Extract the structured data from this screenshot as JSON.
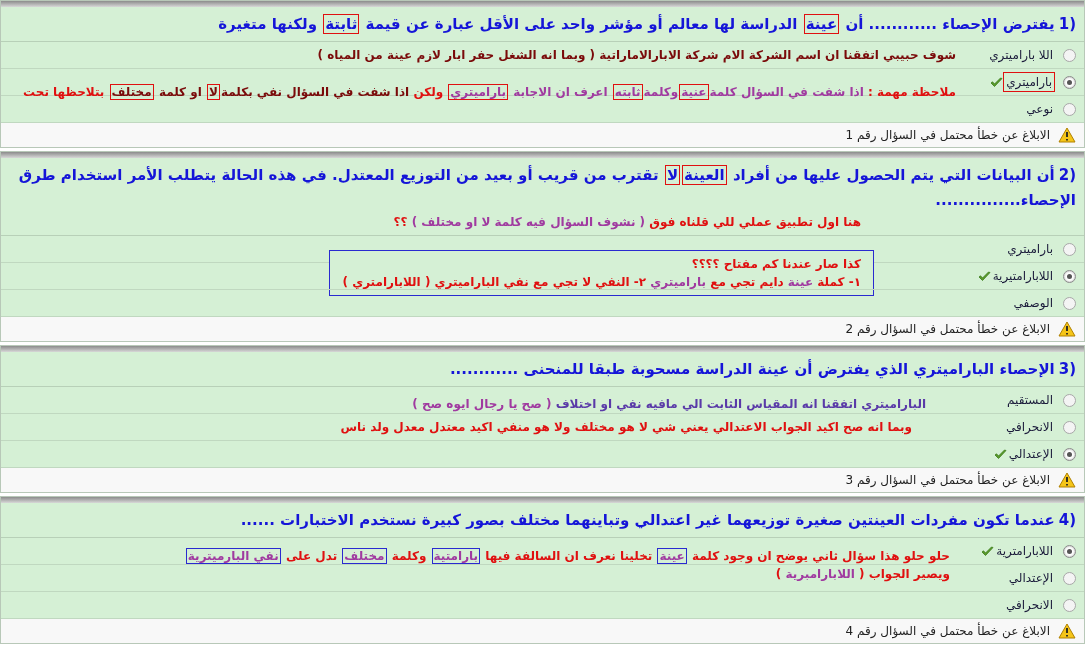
{
  "questions": [
    {
      "number": "1)",
      "text": [
        {
          "text": "يفترض الإحصاء ............ أن ",
          "color": "#1515d8"
        },
        {
          "text": "عينة",
          "color": "#1515d8",
          "boxed": true
        },
        {
          "text": " الدراسة لها معالم أو مؤشر واحد على الأقل عبارة عن قيمة ",
          "color": "#1515d8"
        },
        {
          "text": "ثابتة",
          "color": "#1515d8",
          "boxed": true
        },
        {
          "text": " ولكنها متغيرة",
          "color": "#1515d8"
        }
      ],
      "options": [
        {
          "label": "اللا باراميتري",
          "selected": false,
          "correct": false,
          "notes": [
            {
              "kind": "plain",
              "lines": [
                [
                  {
                    "text": "شوف حبيبي اتفقنا ان اسم الشركة الام شركة الابارالاماراتية ( وبما انه الشغل حفر ابار لازم عينة من المياه )",
                    "color": "#7a0a0a"
                  }
                ]
              ]
            }
          ]
        },
        {
          "label": "باراميتري",
          "selected": true,
          "correct": true,
          "boxed": true,
          "notes": [
            {
              "kind": "plain",
              "lines": [
                [
                  {
                    "text": "ملاحظة مهمة : ",
                    "color": "#e01010"
                  },
                  {
                    "text": "اذا شفت في السؤال كلمة",
                    "color": "#a03aa0"
                  },
                  {
                    "text": "عنية",
                    "color": "#a03aa0",
                    "boxed": true
                  },
                  {
                    "text": "وكلمة",
                    "color": "#a03aa0"
                  },
                  {
                    "text": "ثابته",
                    "color": "#a03aa0",
                    "boxed": true
                  },
                  {
                    "text": " اعرف ان الاجابة ",
                    "color": "#a03aa0"
                  },
                  {
                    "text": "باراميتري",
                    "color": "#a03aa0",
                    "boxed": true
                  },
                  {
                    "text": " ولكن ",
                    "color": "#e01010"
                  },
                  {
                    "text": "اذا شفت في السؤال نفي بكلمة",
                    "color": "#7a0a0a"
                  },
                  {
                    "text": "لا",
                    "color": "#7a0a0a",
                    "boxed": true
                  },
                  {
                    "text": " او كلمة ",
                    "color": "#7a0a0a"
                  },
                  {
                    "text": "مختلف",
                    "color": "#7a0a0a",
                    "boxed": true
                  },
                  {
                    "text": " بتلاحظها تحت",
                    "color": "#e01010"
                  }
                ]
              ]
            }
          ]
        },
        {
          "label": "نوعي",
          "selected": false,
          "correct": false
        }
      ],
      "report": "الابلاغ عن خطأ محتمل في السؤال رقم 1"
    },
    {
      "number": "2)",
      "text": [
        {
          "text": "أن البيانات التي يتم الحصول عليها من أفراد ",
          "color": "#1515d8"
        },
        {
          "text": "العينة",
          "color": "#1515d8",
          "boxed": true
        },
        {
          "text": "لا",
          "color": "#1515d8",
          "boxed": true
        },
        {
          "text": " تقترب من قريب أو بعيد من التوزيع المعتدل. في هذه الحالة يتطلب الأمر استخدام طرق الإحصاء...............",
          "color": "#1515d8"
        }
      ],
      "header_note": {
        "kind": "plain",
        "lines": [
          [
            {
              "text": "هنا اول تطبيق عملي للي قلناه فوق ",
              "color": "#e01010"
            },
            {
              "text": "( نشوف السؤال فيه كلمة لا او مختلف )",
              "color": "#a03aa0"
            },
            {
              "text": " ؟؟",
              "color": "#e01010"
            }
          ]
        ]
      },
      "options": [
        {
          "label": "باراميتري",
          "selected": false,
          "correct": false,
          "notes": [
            {
              "kind": "framed",
              "lines": [
                [
                  {
                    "text": "كذا صار عندنا كم مفتاح ؟؟؟؟",
                    "color": "#e01010"
                  }
                ],
                [
                  {
                    "text": "١- كملة ",
                    "color": "#e01010"
                  },
                  {
                    "text": "عينة",
                    "color": "#a03aa0"
                  },
                  {
                    "text": " دايم تجي مع ",
                    "color": "#e01010"
                  },
                  {
                    "text": "باراميتري",
                    "color": "#a03aa0"
                  },
                  {
                    "text": "  ٢- النفي لا تجي مع نفي الباراميتري ( اللابارامتري )",
                    "color": "#e01010"
                  }
                ]
              ]
            }
          ]
        },
        {
          "label": "اللابارامتيرية",
          "selected": true,
          "correct": true
        },
        {
          "label": "الوصفي",
          "selected": false,
          "correct": false
        }
      ],
      "report": "الابلاغ عن خطأ محتمل في السؤال رقم 2"
    },
    {
      "number": "3)",
      "text": [
        {
          "text": "الإحصاء الباراميتري الذي يفترض أن عينة الدراسة مسحوبة طبقا للمنحنى ............",
          "color": "#1515d8"
        }
      ],
      "options": [
        {
          "label": "المستقيم",
          "selected": false,
          "correct": false,
          "notes": [
            {
              "kind": "plain",
              "lines": [
                [
                  {
                    "text": "الباراميتري اتفقنا انه المقياس الثابت الي مافيه نفي او اختلاف ",
                    "color": "#5a3aa8"
                  },
                  {
                    "text": "( صح يا رجال ايوه صح )",
                    "color": "#a03aa0"
                  }
                ]
              ]
            }
          ]
        },
        {
          "label": "الانحرافي",
          "selected": false,
          "correct": false,
          "notes": [
            {
              "kind": "plain",
              "lines": [
                [
                  {
                    "text": "وبما انه صح اكيد الجواب الاعتدالي يعني شي لا هو مختلف ولا هو منفي اكيد معتدل معدل ولد ناس",
                    "color": "#e01010"
                  }
                ]
              ]
            }
          ]
        },
        {
          "label": "الإعتدالي",
          "selected": true,
          "correct": true
        }
      ],
      "report": "الابلاغ عن خطأ محتمل في السؤال رقم 3"
    },
    {
      "number": "4)",
      "text": [
        {
          "text": "عندما تكون مفردات العينتين صغيرة توزيعهما غير اعتدالي وتباينهما مختلف بصور كبيرة نستخدم الاختبارات ......",
          "color": "#1515d8"
        }
      ],
      "options": [
        {
          "label": "اللابارامترية",
          "selected": true,
          "correct": true,
          "notes": [
            {
              "kind": "plain",
              "lines": [
                [
                  {
                    "text": "حلو حلو هذا سؤال ثاني يوضح ان وجود كلمة ",
                    "color": "#e01010"
                  },
                  {
                    "text": "عينة",
                    "color": "#a03aa0",
                    "boxed": true
                  },
                  {
                    "text": " تخلينا نعرف ان السالفة فيها ",
                    "color": "#e01010"
                  },
                  {
                    "text": "بارامتية",
                    "color": "#a03aa0",
                    "boxed": true
                  },
                  {
                    "text": " وكلمة ",
                    "color": "#e01010"
                  },
                  {
                    "text": "مختلف",
                    "color": "#a03aa0",
                    "boxed": true
                  },
                  {
                    "text": " تدل على ",
                    "color": "#e01010"
                  },
                  {
                    "text": "نفي البارميترية",
                    "color": "#a03aa0",
                    "boxed": true
                  }
                ],
                [
                  {
                    "text": "ويصير الجواب ( ",
                    "color": "#e01010"
                  },
                  {
                    "text": "اللابارامبرية",
                    "color": "#a03aa0"
                  },
                  {
                    "text": " )",
                    "color": "#e01010"
                  }
                ]
              ]
            }
          ]
        },
        {
          "label": "الإعتدالي",
          "selected": false,
          "correct": false
        },
        {
          "label": "الانحرافي",
          "selected": false,
          "correct": false
        }
      ],
      "report": "الابلاغ عن خطأ محتمل في السؤال رقم 4"
    }
  ]
}
